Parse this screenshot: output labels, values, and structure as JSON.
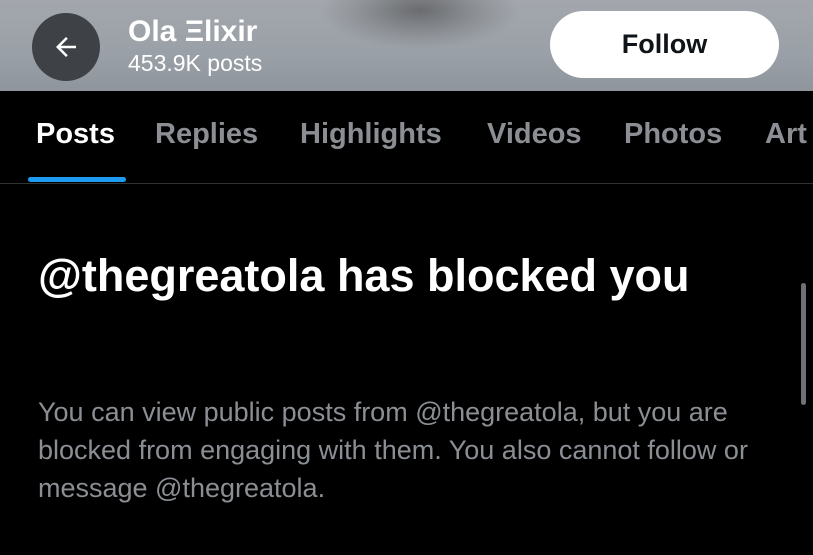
{
  "header": {
    "back_icon": "arrow-left-icon",
    "profile_name": "Ola Ξlixir",
    "post_count": "453.9K posts",
    "follow_label": "Follow"
  },
  "tabs": {
    "items": [
      {
        "label": "Posts",
        "active": true
      },
      {
        "label": "Replies",
        "active": false
      },
      {
        "label": "Highlights",
        "active": false
      },
      {
        "label": "Videos",
        "active": false
      },
      {
        "label": "Photos",
        "active": false
      },
      {
        "label": "Art",
        "active": false
      }
    ]
  },
  "blocked_notice": {
    "title": "@thegreatola has blocked you",
    "description": "You can view public posts from @thegreatola, but you are blocked from engaging with them. You also cannot follow or message @thegreatola."
  },
  "colors": {
    "accent": "#1d9bf0",
    "background": "#000000",
    "muted_text": "#8b8f94"
  }
}
